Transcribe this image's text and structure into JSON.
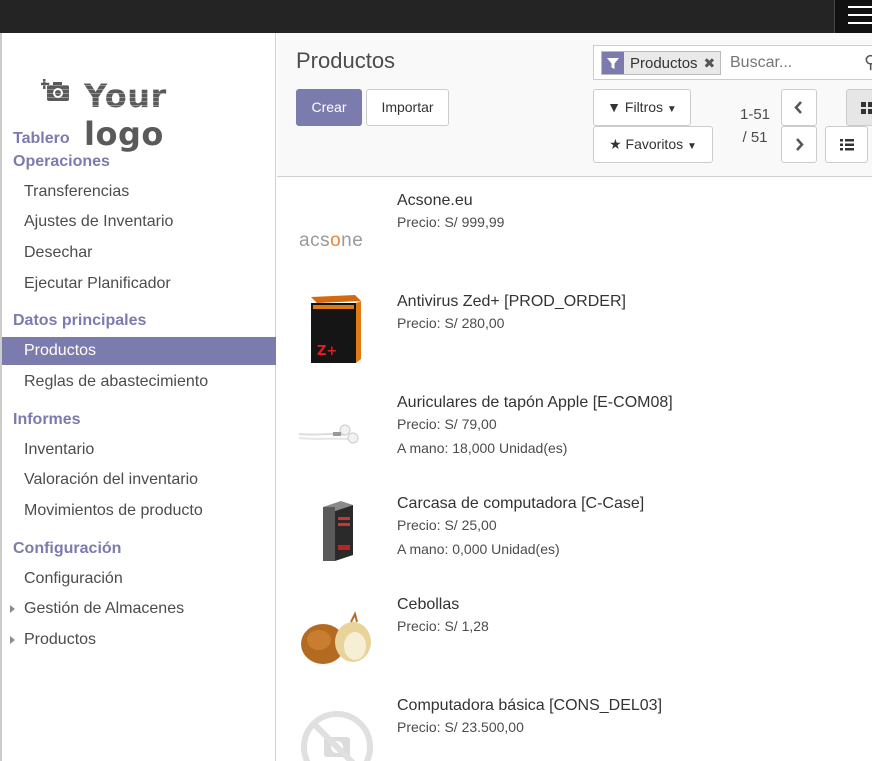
{
  "logo": {
    "text": "Your logo"
  },
  "sidebar": {
    "sections": [
      {
        "title": "Tablero",
        "items": []
      },
      {
        "title": "Operaciones",
        "items": [
          "Transferencias",
          "Ajustes de Inventario",
          "Desechar",
          "Ejecutar Planificador"
        ]
      },
      {
        "title": "Datos principales",
        "items": [
          "Productos",
          "Reglas de abastecimiento"
        ]
      },
      {
        "title": "Informes",
        "items": [
          "Inventario",
          "Valoración del inventario",
          "Movimientos de producto"
        ]
      },
      {
        "title": "Configuración",
        "items": [
          "Configuración",
          "Gestión de Almacenes",
          "Productos"
        ]
      }
    ],
    "active_item": "Productos"
  },
  "control_panel": {
    "title": "Productos",
    "create_label": "Crear",
    "import_label": "Importar",
    "filters_label": "Filtros",
    "favorites_label": "Favoritos",
    "pager_range": "1-51",
    "pager_total": "/ 51"
  },
  "search": {
    "facet_label": "Productos",
    "placeholder": "Buscar..."
  },
  "records": [
    {
      "name": "Acsone.eu",
      "price": "Precio: S/ 999,99",
      "stock": "",
      "image": "acsone-logo"
    },
    {
      "name": "Antivirus Zed+ [PROD_ORDER]",
      "price": "Precio: S/ 280,00",
      "stock": "",
      "image": "software-box"
    },
    {
      "name": "Auriculares de tapón Apple [E-COM08]",
      "price": "Precio: S/ 79,00",
      "stock": "A mano: 18,000 Unidad(es)",
      "image": "earphones"
    },
    {
      "name": "Carcasa de computadora [C-Case]",
      "price": "Precio: S/ 25,00",
      "stock": "A mano: 0,000 Unidad(es)",
      "image": "pc-case"
    },
    {
      "name": "Cebollas",
      "price": "Precio: S/ 1,28",
      "stock": "",
      "image": "onions"
    },
    {
      "name": "Computadora básica [CONS_DEL03]",
      "price": "Precio: S/ 23.500,00",
      "stock": "",
      "image": "no-image"
    }
  ],
  "colors": {
    "accent": "#7c7bad",
    "topbar": "#242424"
  }
}
